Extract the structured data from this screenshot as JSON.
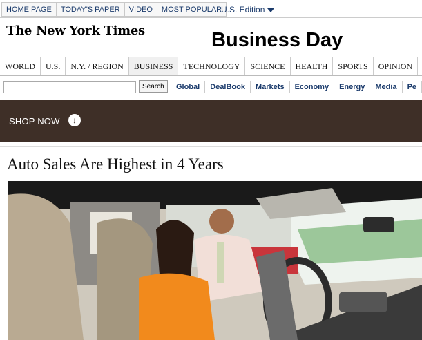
{
  "top_nav": {
    "items": [
      "HOME PAGE",
      "TODAY'S PAPER",
      "VIDEO",
      "MOST POPULAR"
    ],
    "edition_label": "U.S. Edition"
  },
  "masthead": {
    "logo_text": "The New York Times",
    "section_title": "Business Day"
  },
  "section_tabs": [
    "WORLD",
    "U.S.",
    "N.Y. / REGION",
    "BUSINESS",
    "TECHNOLOGY",
    "SCIENCE",
    "HEALTH",
    "SPORTS",
    "OPINION"
  ],
  "search": {
    "button_label": "Search",
    "input_value": ""
  },
  "sub_nav": [
    "Global",
    "DealBook",
    "Markets",
    "Economy",
    "Energy",
    "Media",
    "Pe"
  ],
  "banner": {
    "label": "SHOP NOW",
    "icon": "arrow-down-circle-icon",
    "background": "#3e2f27"
  },
  "article": {
    "headline": "Auto Sales Are Highest in 4 Years"
  },
  "colors": {
    "link": "#1a3a6b"
  }
}
